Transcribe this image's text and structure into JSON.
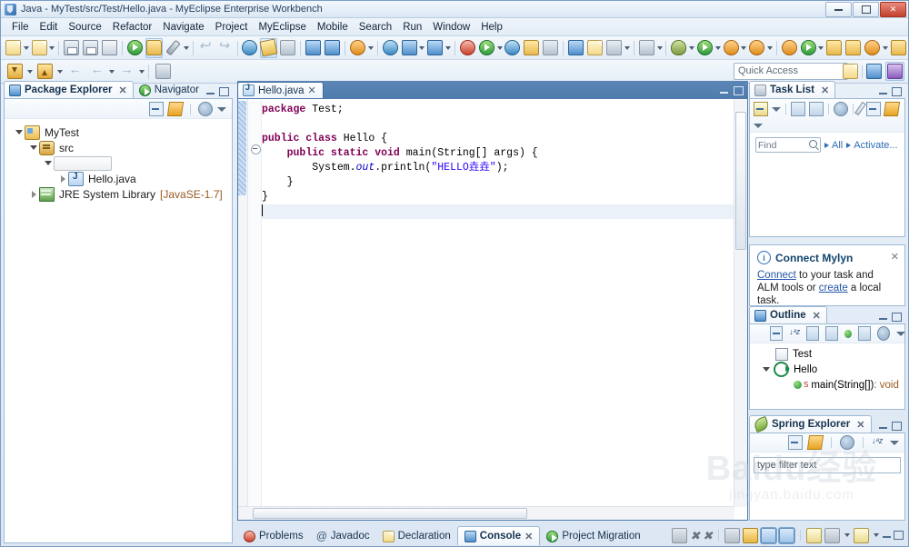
{
  "window": {
    "title": "Java - MyTest/src/Test/Hello.java - MyEclipse Enterprise Workbench",
    "app_icon": "myeclipse-icon",
    "buttons": {
      "minimize": "minimize-button",
      "restore": "restore-button",
      "close": "close-button"
    }
  },
  "menubar": {
    "items": [
      {
        "label": "File"
      },
      {
        "label": "Edit"
      },
      {
        "label": "Source"
      },
      {
        "label": "Refactor"
      },
      {
        "label": "Navigate"
      },
      {
        "label": "Project"
      },
      {
        "label": "MyEclipse"
      },
      {
        "label": "Mobile"
      },
      {
        "label": "Search"
      },
      {
        "label": "Run"
      },
      {
        "label": "Window"
      },
      {
        "label": "Help"
      }
    ]
  },
  "toolbar": {
    "quick_access_placeholder": "Quick Access",
    "perspective_buttons": [
      "open-perspective-icon",
      "java-perspective-icon",
      "myeclipse-perspective-icon"
    ]
  },
  "package_explorer": {
    "tabs": [
      {
        "label": "Package Explorer",
        "active": true,
        "closable": true,
        "icon": "package-explorer-icon"
      },
      {
        "label": "Navigator",
        "active": false,
        "closable": false,
        "icon": "navigator-icon"
      }
    ],
    "view_buttons": [
      "collapse-all-icon",
      "link-with-editor-icon",
      "view-menu-icon",
      "view-dropdown-icon"
    ],
    "tree": [
      {
        "label": "MyTest",
        "icon": "java-project-icon",
        "depth": 0,
        "twist": "open"
      },
      {
        "label": "src",
        "icon": "source-folder-icon",
        "depth": 1,
        "twist": "open"
      },
      {
        "label": "",
        "icon": "package-editing-icon",
        "depth": 2,
        "twist": "open",
        "editing": true
      },
      {
        "label": "Hello.java",
        "icon": "java-file-icon",
        "depth": 3,
        "twist": "closed"
      },
      {
        "label": "JRE System Library",
        "suffix": "[JavaSE-1.7]",
        "icon": "jre-library-icon",
        "depth": 1,
        "twist": "closed"
      }
    ]
  },
  "editor": {
    "tab": {
      "label": "Hello.java",
      "icon": "java-file-icon",
      "closable": true
    },
    "lines": [
      {
        "text": "package Test;",
        "tokens": [
          {
            "t": "package",
            "c": "kw"
          },
          {
            "t": " Test;",
            "c": ""
          }
        ]
      },
      {
        "text": ""
      },
      {
        "text": "public class Hello {",
        "tokens": [
          {
            "t": "public class",
            "c": "kw"
          },
          {
            "t": " Hello {",
            "c": ""
          }
        ]
      },
      {
        "text": "    public static void main(String[] args) {",
        "fold": true
      },
      {
        "text": "        System.out.println(\"HELLO垚垚\");"
      },
      {
        "text": "    }"
      },
      {
        "text": "}"
      },
      {
        "text": "",
        "current": true
      }
    ],
    "code_text": {
      "l1_kw": "package",
      "l1_rest": " Test;",
      "l3_kw": "public class",
      "l3_rest": " Hello {",
      "l4_kw": "public static void",
      "l4_rest": " main(String[] args) {",
      "l5_a": "System.",
      "l5_fld": "out",
      "l5_b": ".println(",
      "l5_str": "\"HELLO垚垚\"",
      "l5_c": ");",
      "l6": "}",
      "l7": "}"
    }
  },
  "task_list": {
    "tab": {
      "label": "Task List",
      "icon": "task-list-icon",
      "closable": true
    },
    "toolbar_icons": [
      "new-task-icon",
      "new-task-dropdown-icon",
      "categorized-mode-icon",
      "scheduled-mode-icon",
      "focus-on-workweek-icon",
      "collapse-all-icon",
      "synchronize-changed-icon",
      "view-menu-icon"
    ],
    "find_placeholder": "Find",
    "filters": [
      {
        "label": "All"
      },
      {
        "label": "Activate..."
      }
    ]
  },
  "mylyn": {
    "title": "Connect Mylyn",
    "icon": "info-icon",
    "close": "close-icon",
    "text_before": "",
    "link1": "Connect",
    "text_middle": " to your task and ALM tools or ",
    "link2": "create",
    "text_after": " a local task."
  },
  "outline": {
    "tab": {
      "label": "Outline",
      "icon": "outline-icon",
      "closable": true
    },
    "toolbar_icons": [
      "collapse-all-icon",
      "sort-icon",
      "hide-fields-icon",
      "hide-static-icon",
      "hide-non-public-icon",
      "hide-local-types-icon",
      "view-menu-icon",
      "view-dropdown-icon"
    ],
    "items": [
      {
        "label": "Test",
        "icon": "package-icon",
        "depth": 0
      },
      {
        "label": "Hello",
        "icon": "class-icon",
        "depth": 0,
        "twist": "open"
      },
      {
        "label": "main(String[])",
        "suffix": " : void",
        "icon": "public-method-icon",
        "modifier": "S",
        "depth": 1
      }
    ]
  },
  "spring_explorer": {
    "tab": {
      "label": "Spring Explorer",
      "icon": "spring-leaf-icon",
      "closable": true
    },
    "toolbar_icons": [
      "collapse-all-icon",
      "link-with-editor-icon",
      "view-menu-icon",
      "sort-icon",
      "view-dropdown-icon"
    ],
    "filter_placeholder": "type filter text"
  },
  "bottom_panel": {
    "tabs": [
      {
        "label": "Problems",
        "icon": "problems-icon",
        "active": false
      },
      {
        "label": "Javadoc",
        "icon": "javadoc-icon",
        "active": false
      },
      {
        "label": "Declaration",
        "icon": "declaration-icon",
        "active": false
      },
      {
        "label": "Console",
        "icon": "console-icon",
        "active": true,
        "closable": true
      },
      {
        "label": "Project Migration",
        "icon": "project-migration-icon",
        "active": false
      }
    ],
    "toolbar_icons": [
      "terminate-icon",
      "remove-launch-icon",
      "remove-all-terminated-icon",
      "clear-console-icon",
      "scroll-lock-icon",
      "pin-console-icon",
      "show-console-icon",
      "display-selected-console-icon",
      "open-console-icon",
      "minimize-icon",
      "maximize-icon"
    ]
  },
  "watermark": {
    "line1": "Baidu经验",
    "line2": "jingyan.baidu.com"
  },
  "colors": {
    "accent": "#4f7cad",
    "keyword": "#7f0055",
    "string": "#2a00ff",
    "field": "#0000c0",
    "link": "#2255aa",
    "dim": "#9a5b20"
  }
}
